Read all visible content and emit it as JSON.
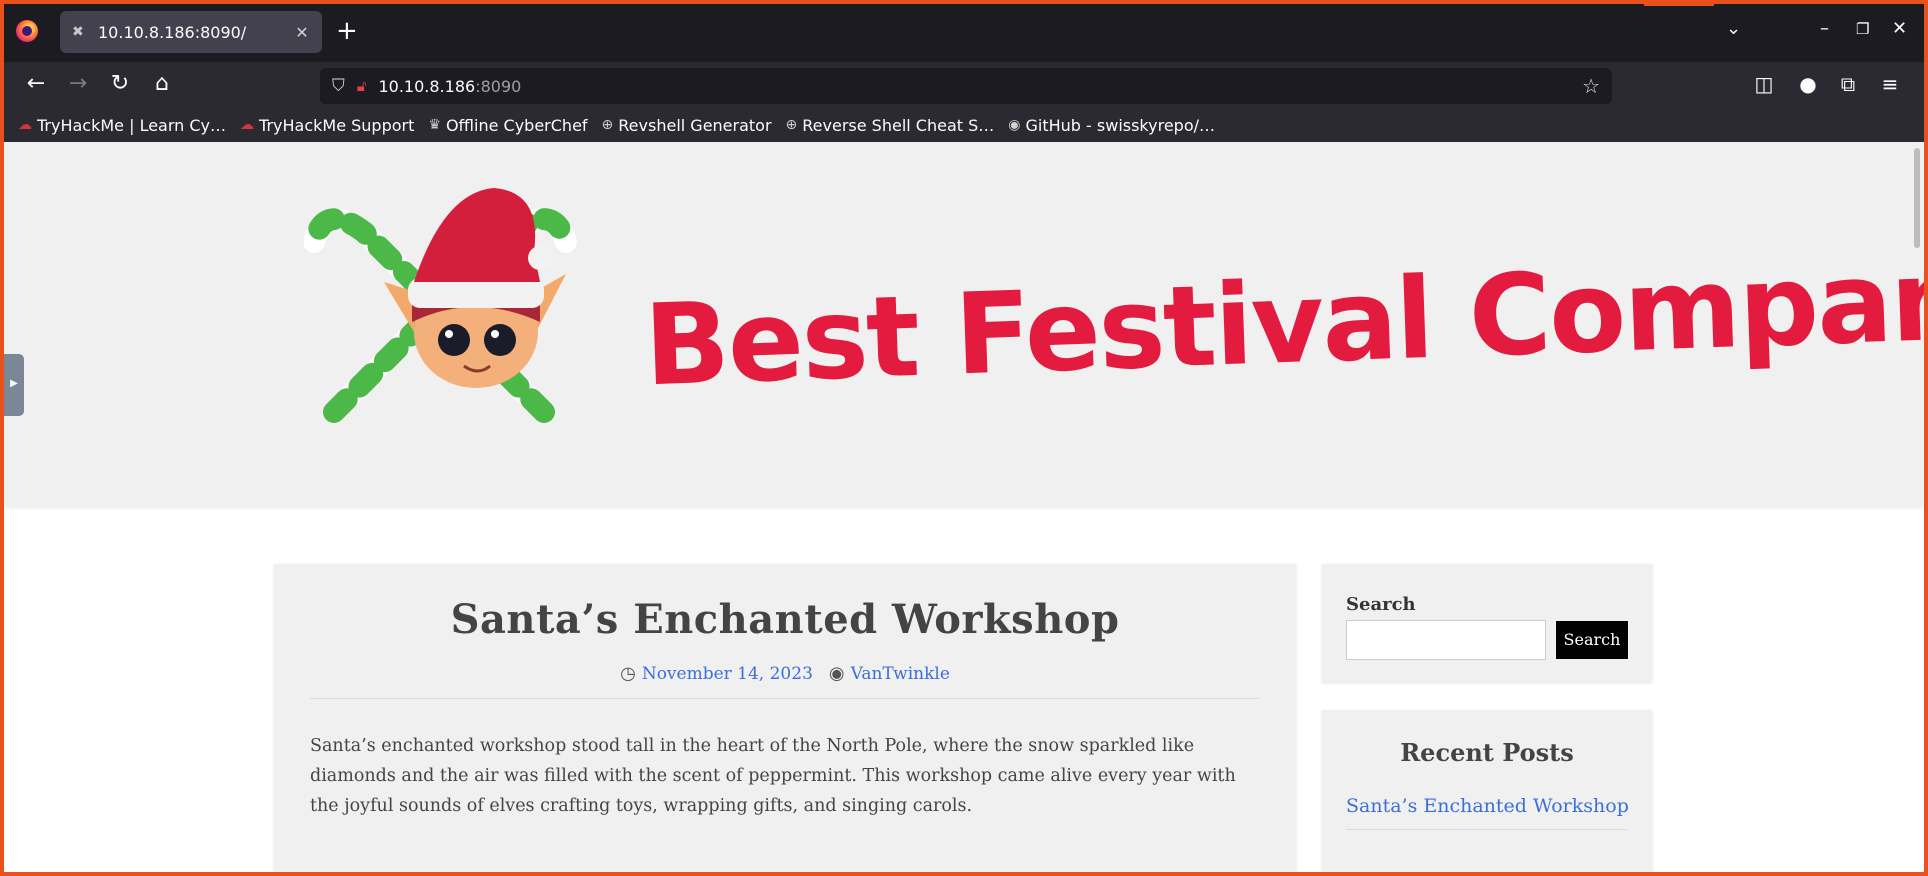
{
  "browser": {
    "tab": {
      "title": "10.10.8.186:8090/",
      "close": "✕"
    },
    "new_tab": "+",
    "url": {
      "host": "10.10.8.186",
      "port": ":8090"
    },
    "bookmarks": [
      {
        "label": "TryHackMe | Learn Cy…",
        "icon": "tryhackme-cloud-icon"
      },
      {
        "label": "TryHackMe Support",
        "icon": "tryhackme-cloud-icon"
      },
      {
        "label": "Offline CyberChef",
        "icon": "chef-hat-icon"
      },
      {
        "label": "Revshell Generator",
        "icon": "globe-icon"
      },
      {
        "label": "Reverse Shell Cheat S…",
        "icon": "globe-icon"
      },
      {
        "label": "GitHub - swisskyrepo/…",
        "icon": "github-icon"
      }
    ]
  },
  "site": {
    "brand": "Best Festival Company",
    "post": {
      "title": "Santa’s Enchanted Workshop",
      "date": "November 14, 2023",
      "author": "VanTwinkle",
      "body": "Santa’s enchanted workshop stood tall in the heart of the North Pole, where the snow sparkled like diamonds and the air was filled with the scent of peppermint. This workshop came alive every year with the joyful sounds of elves crafting toys, wrapping gifts, and singing carols."
    },
    "sidebar": {
      "search_label": "Search",
      "search_button": "Search",
      "search_value": "",
      "recent_title": "Recent Posts",
      "recent_posts": [
        "Santa’s Enchanted Workshop"
      ]
    }
  },
  "colors": {
    "brand_red": "#e31b3e",
    "link_blue": "#3a6fd8",
    "frame_orange": "#e8501c"
  }
}
